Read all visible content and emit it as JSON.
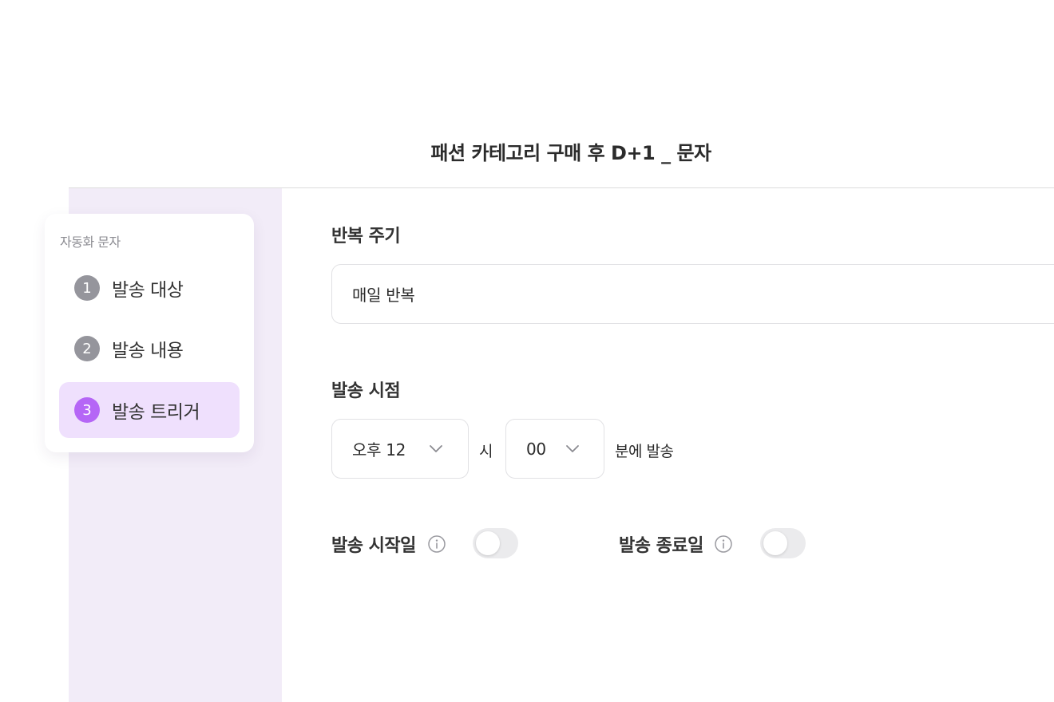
{
  "header": {
    "title": "패션 카테고리 구매 후 D+1 _ 문자"
  },
  "steps_card": {
    "label": "자동화 문자",
    "items": [
      {
        "number": "1",
        "label": "발송 대상",
        "active": false
      },
      {
        "number": "2",
        "label": "발송 내용",
        "active": false
      },
      {
        "number": "3",
        "label": "발송 트리거",
        "active": true
      }
    ]
  },
  "repeat": {
    "label": "반복 주기",
    "value": "매일 반복",
    "icon": "chevron-down-icon"
  },
  "send_time": {
    "label": "발송 시점",
    "hour_value": "오후 12",
    "hour_suffix": "시",
    "minute_value": "00",
    "minute_suffix": "분에 발송"
  },
  "start_date": {
    "label": "발송 시작일",
    "icon": "info-icon",
    "enabled": false
  },
  "end_date": {
    "label": "발송 종료일",
    "icon": "info-icon",
    "enabled": false
  },
  "colors": {
    "accent": "#b566f6",
    "active_step_bg": "#efe0fd",
    "side_panel_bg": "#f2ecf8",
    "inactive_step": "#95959c"
  }
}
